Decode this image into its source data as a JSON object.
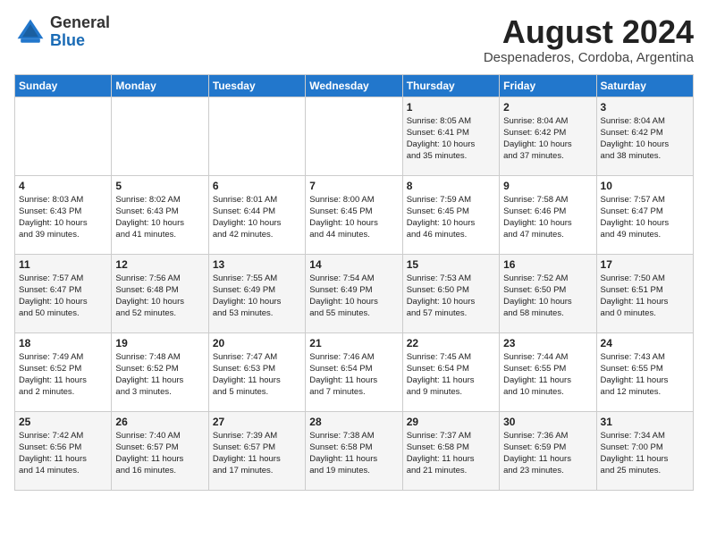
{
  "header": {
    "logo_general": "General",
    "logo_blue": "Blue",
    "month_year": "August 2024",
    "location": "Despenaderos, Cordoba, Argentina"
  },
  "weekdays": [
    "Sunday",
    "Monday",
    "Tuesday",
    "Wednesday",
    "Thursday",
    "Friday",
    "Saturday"
  ],
  "weeks": [
    [
      {
        "day": "",
        "content": ""
      },
      {
        "day": "",
        "content": ""
      },
      {
        "day": "",
        "content": ""
      },
      {
        "day": "",
        "content": ""
      },
      {
        "day": "1",
        "content": "Sunrise: 8:05 AM\nSunset: 6:41 PM\nDaylight: 10 hours\nand 35 minutes."
      },
      {
        "day": "2",
        "content": "Sunrise: 8:04 AM\nSunset: 6:42 PM\nDaylight: 10 hours\nand 37 minutes."
      },
      {
        "day": "3",
        "content": "Sunrise: 8:04 AM\nSunset: 6:42 PM\nDaylight: 10 hours\nand 38 minutes."
      }
    ],
    [
      {
        "day": "4",
        "content": "Sunrise: 8:03 AM\nSunset: 6:43 PM\nDaylight: 10 hours\nand 39 minutes."
      },
      {
        "day": "5",
        "content": "Sunrise: 8:02 AM\nSunset: 6:43 PM\nDaylight: 10 hours\nand 41 minutes."
      },
      {
        "day": "6",
        "content": "Sunrise: 8:01 AM\nSunset: 6:44 PM\nDaylight: 10 hours\nand 42 minutes."
      },
      {
        "day": "7",
        "content": "Sunrise: 8:00 AM\nSunset: 6:45 PM\nDaylight: 10 hours\nand 44 minutes."
      },
      {
        "day": "8",
        "content": "Sunrise: 7:59 AM\nSunset: 6:45 PM\nDaylight: 10 hours\nand 46 minutes."
      },
      {
        "day": "9",
        "content": "Sunrise: 7:58 AM\nSunset: 6:46 PM\nDaylight: 10 hours\nand 47 minutes."
      },
      {
        "day": "10",
        "content": "Sunrise: 7:57 AM\nSunset: 6:47 PM\nDaylight: 10 hours\nand 49 minutes."
      }
    ],
    [
      {
        "day": "11",
        "content": "Sunrise: 7:57 AM\nSunset: 6:47 PM\nDaylight: 10 hours\nand 50 minutes."
      },
      {
        "day": "12",
        "content": "Sunrise: 7:56 AM\nSunset: 6:48 PM\nDaylight: 10 hours\nand 52 minutes."
      },
      {
        "day": "13",
        "content": "Sunrise: 7:55 AM\nSunset: 6:49 PM\nDaylight: 10 hours\nand 53 minutes."
      },
      {
        "day": "14",
        "content": "Sunrise: 7:54 AM\nSunset: 6:49 PM\nDaylight: 10 hours\nand 55 minutes."
      },
      {
        "day": "15",
        "content": "Sunrise: 7:53 AM\nSunset: 6:50 PM\nDaylight: 10 hours\nand 57 minutes."
      },
      {
        "day": "16",
        "content": "Sunrise: 7:52 AM\nSunset: 6:50 PM\nDaylight: 10 hours\nand 58 minutes."
      },
      {
        "day": "17",
        "content": "Sunrise: 7:50 AM\nSunset: 6:51 PM\nDaylight: 11 hours\nand 0 minutes."
      }
    ],
    [
      {
        "day": "18",
        "content": "Sunrise: 7:49 AM\nSunset: 6:52 PM\nDaylight: 11 hours\nand 2 minutes."
      },
      {
        "day": "19",
        "content": "Sunrise: 7:48 AM\nSunset: 6:52 PM\nDaylight: 11 hours\nand 3 minutes."
      },
      {
        "day": "20",
        "content": "Sunrise: 7:47 AM\nSunset: 6:53 PM\nDaylight: 11 hours\nand 5 minutes."
      },
      {
        "day": "21",
        "content": "Sunrise: 7:46 AM\nSunset: 6:54 PM\nDaylight: 11 hours\nand 7 minutes."
      },
      {
        "day": "22",
        "content": "Sunrise: 7:45 AM\nSunset: 6:54 PM\nDaylight: 11 hours\nand 9 minutes."
      },
      {
        "day": "23",
        "content": "Sunrise: 7:44 AM\nSunset: 6:55 PM\nDaylight: 11 hours\nand 10 minutes."
      },
      {
        "day": "24",
        "content": "Sunrise: 7:43 AM\nSunset: 6:55 PM\nDaylight: 11 hours\nand 12 minutes."
      }
    ],
    [
      {
        "day": "25",
        "content": "Sunrise: 7:42 AM\nSunset: 6:56 PM\nDaylight: 11 hours\nand 14 minutes."
      },
      {
        "day": "26",
        "content": "Sunrise: 7:40 AM\nSunset: 6:57 PM\nDaylight: 11 hours\nand 16 minutes."
      },
      {
        "day": "27",
        "content": "Sunrise: 7:39 AM\nSunset: 6:57 PM\nDaylight: 11 hours\nand 17 minutes."
      },
      {
        "day": "28",
        "content": "Sunrise: 7:38 AM\nSunset: 6:58 PM\nDaylight: 11 hours\nand 19 minutes."
      },
      {
        "day": "29",
        "content": "Sunrise: 7:37 AM\nSunset: 6:58 PM\nDaylight: 11 hours\nand 21 minutes."
      },
      {
        "day": "30",
        "content": "Sunrise: 7:36 AM\nSunset: 6:59 PM\nDaylight: 11 hours\nand 23 minutes."
      },
      {
        "day": "31",
        "content": "Sunrise: 7:34 AM\nSunset: 7:00 PM\nDaylight: 11 hours\nand 25 minutes."
      }
    ]
  ]
}
